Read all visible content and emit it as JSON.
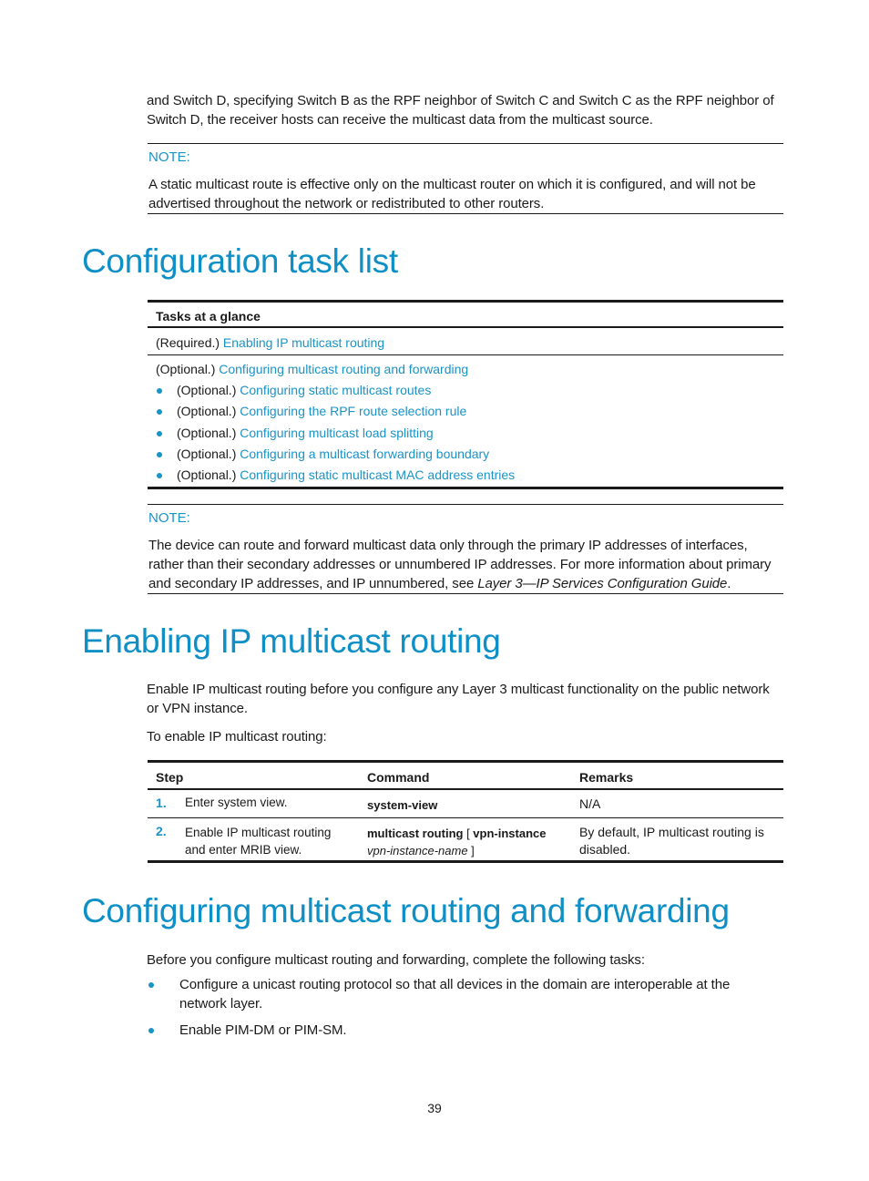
{
  "intro": {
    "line1": "and Switch D, specifying Switch B as the RPF neighbor of Switch C and Switch C as the RPF neighbor of",
    "line2": "Switch D, the receiver hosts can receive the multicast data from the multicast source."
  },
  "note1": {
    "label": "NOTE:",
    "line1": "A static multicast route is effective only on the multicast router on which it is configured, and will not be",
    "line2": "advertised throughout the network or redistributed to other routers."
  },
  "section1": {
    "title": "Configuration task list",
    "table": {
      "header": "Tasks at a glance",
      "required": {
        "prefix": "(Required.) ",
        "link": "Enabling IP multicast routing"
      },
      "optional": {
        "prefix": "(Optional.) ",
        "link": "Configuring multicast routing and forwarding"
      },
      "subitems": [
        {
          "prefix": "(Optional.) ",
          "link": "Configuring static multicast routes"
        },
        {
          "prefix": "(Optional.) ",
          "link": "Configuring the RPF route selection rule"
        },
        {
          "prefix": "(Optional.) ",
          "link": "Configuring multicast load splitting"
        },
        {
          "prefix": "(Optional.) ",
          "link": "Configuring a multicast forwarding boundary"
        },
        {
          "prefix": "(Optional.) ",
          "link": "Configuring static multicast MAC address entries"
        }
      ]
    }
  },
  "note2": {
    "label": "NOTE:",
    "line1": "The device can route and forward multicast data only through the primary IP addresses of interfaces,",
    "line2": "rather than their secondary addresses or unnumbered IP addresses. For more information about primary",
    "line3_prefix": "and secondary IP addresses, and IP unnumbered, see ",
    "line3_ref": "Layer 3—IP Services Configuration Guide",
    "line3_suffix": "."
  },
  "section2": {
    "title": "Enabling IP multicast routing",
    "para_line1": "Enable IP multicast routing before you configure any Layer 3 multicast functionality on the public network",
    "para_line2": "or VPN instance.",
    "lead": "To enable IP multicast routing:",
    "table": {
      "headers": [
        "Step",
        "Command",
        "Remarks"
      ],
      "rows": [
        {
          "num": "1.",
          "step": "Enter system view.",
          "cmd_bold": "system-view",
          "remarks": "N/A"
        },
        {
          "num": "2.",
          "step_line1": "Enable IP multicast routing",
          "step_line2": "and enter MRIB view.",
          "cmd_bold1": "multicast routing",
          "cmd_bracket_open": " [ ",
          "cmd_bold2": "vpn-instance",
          "cmd_italic": "vpn-instance-name",
          "cmd_bracket_close": " ]",
          "remarks_line1": "By default, IP multicast routing is",
          "remarks_line2": "disabled."
        }
      ]
    }
  },
  "section3": {
    "title": "Configuring multicast routing and forwarding",
    "lead": "Before you configure multicast routing and forwarding, complete the following tasks:",
    "bullets": [
      {
        "line1": "Configure a unicast routing protocol so that all devices in the domain are interoperable at the",
        "line2": "network layer."
      },
      {
        "line1": "Enable PIM-DM or PIM-SM."
      }
    ]
  },
  "footer": {
    "page_number": "39"
  },
  "colors": {
    "accent": "#1a93c7",
    "heading": "#0e8fc6",
    "text": "#1a1a1a"
  }
}
